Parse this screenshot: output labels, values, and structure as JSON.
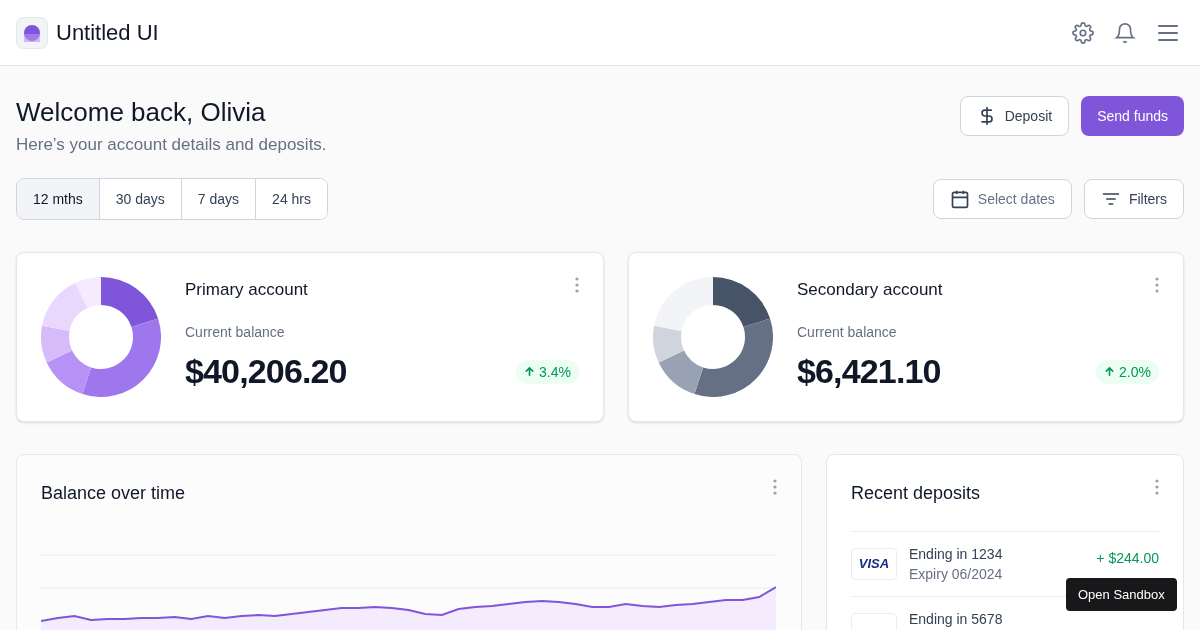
{
  "header": {
    "brand": "Untitled UI"
  },
  "page": {
    "title": "Welcome back, Olivia",
    "subtitle": "Here’s your account details and deposits."
  },
  "actions": [
    {
      "kind": "secondary",
      "label": "Deposit"
    },
    {
      "kind": "primary",
      "label": "Send funds"
    }
  ],
  "ranges": [
    {
      "label": "12 mths",
      "selected": true
    },
    {
      "label": "30 days",
      "selected": false
    },
    {
      "label": "7 days",
      "selected": false
    },
    {
      "label": "24 hrs",
      "selected": false
    }
  ],
  "filters": {
    "dates": "Select dates",
    "filters": "Filters"
  },
  "accounts": [
    {
      "kind": "primary",
      "name": "Primary account",
      "balance_label": "Current balance",
      "balance": "$40,206.20",
      "change": "3.4%"
    },
    {
      "kind": "secondary",
      "name": "Secondary account",
      "balance_label": "Current balance",
      "balance": "$6,421.10",
      "change": "2.0%"
    }
  ],
  "balance_chart": {
    "title": "Balance over time"
  },
  "deposits": {
    "title": "Recent deposits",
    "items": [
      {
        "card": "VISA",
        "title": "Ending in 1234",
        "subtitle": "Expiry 06/2024",
        "amount": "+ $244.00"
      },
      {
        "title": "Ending in 5678"
      }
    ]
  },
  "tooltip": "Open Sandbox"
}
